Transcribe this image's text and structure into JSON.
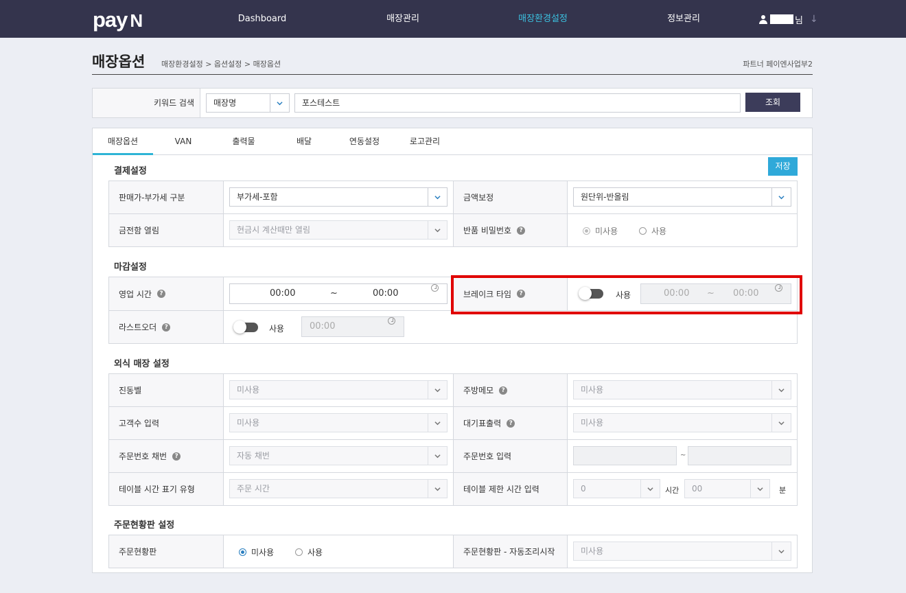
{
  "header": {
    "logo_text": "pay",
    "logo_mark": "N",
    "nav": [
      {
        "label": "Dashboard",
        "active": false
      },
      {
        "label": "매장관리",
        "active": false
      },
      {
        "label": "매장환경설정",
        "active": true
      },
      {
        "label": "정보관리",
        "active": false
      }
    ],
    "user_suffix": "님",
    "user_icon": "person-icon",
    "dropdown_icon": "arrow-down-icon"
  },
  "page": {
    "title": "매장옵션",
    "breadcrumb": "매장환경설정 > 옵션설정 > 매장옵션",
    "partner": "파트너 페이엔사업부2"
  },
  "search": {
    "label": "키워드 검색",
    "type_value": "매장명",
    "keyword_value": "포스테스트",
    "button": "조회"
  },
  "tabs": [
    "매장옵션",
    "VAN",
    "출력물",
    "배달",
    "연동설정",
    "로고관리"
  ],
  "save_button": "저장",
  "payment": {
    "title": "결제설정",
    "vat_label": "판매가-부가세 구분",
    "vat_value": "부가세-포함",
    "rounding_label": "금액보정",
    "rounding_value": "원단위-반올림",
    "drawer_label": "금전함 열림",
    "drawer_value": "현금시 계산때만 열림",
    "refund_pw_label": "반품 비밀번호",
    "refund_pw_options": [
      "미사용",
      "사용"
    ],
    "refund_pw_selected": "미사용"
  },
  "closing": {
    "title": "마감설정",
    "hours_label": "영업 시간",
    "hours_start": "00:00",
    "hours_end": "00:00",
    "tilde": "~",
    "break_label": "브레이크 타임",
    "break_toggle_label": "사용",
    "break_enabled": false,
    "break_start": "00:00",
    "break_end": "00:00",
    "lastorder_label": "라스트오더",
    "lastorder_toggle_label": "사용",
    "lastorder_enabled": false,
    "lastorder_time": "00:00"
  },
  "dinein": {
    "title": "외식 매장 설정",
    "bell_label": "진동벨",
    "bell_value": "미사용",
    "kitchen_memo_label": "주방메모",
    "kitchen_memo_value": "미사용",
    "guest_count_label": "고객수 입력",
    "guest_count_value": "미사용",
    "waiting_print_label": "대기표출력",
    "waiting_print_value": "미사용",
    "order_numbering_label": "주문번호 채번",
    "order_numbering_value": "자동 채번",
    "order_number_input_label": "주문번호 입력",
    "order_number_sep": "~",
    "table_time_type_label": "테이블 시간 표기 유형",
    "table_time_type_value": "주문 시간",
    "table_limit_label": "테이블 제한 시간 입력",
    "table_limit_hours": "0",
    "hours_unit": "시간",
    "table_limit_minutes": "00",
    "minutes_unit": "분"
  },
  "order_board": {
    "title": "주문현황판 설정",
    "board_label": "주문현황판",
    "board_options": [
      "미사용",
      "사용"
    ],
    "board_selected": "미사용",
    "auto_cook_label": "주문현황판 - 자동조리시작",
    "auto_cook_value": "미사용"
  },
  "highlight_color": "#e00000",
  "accent_color": "#2fa9d9",
  "header_color": "#34344d"
}
